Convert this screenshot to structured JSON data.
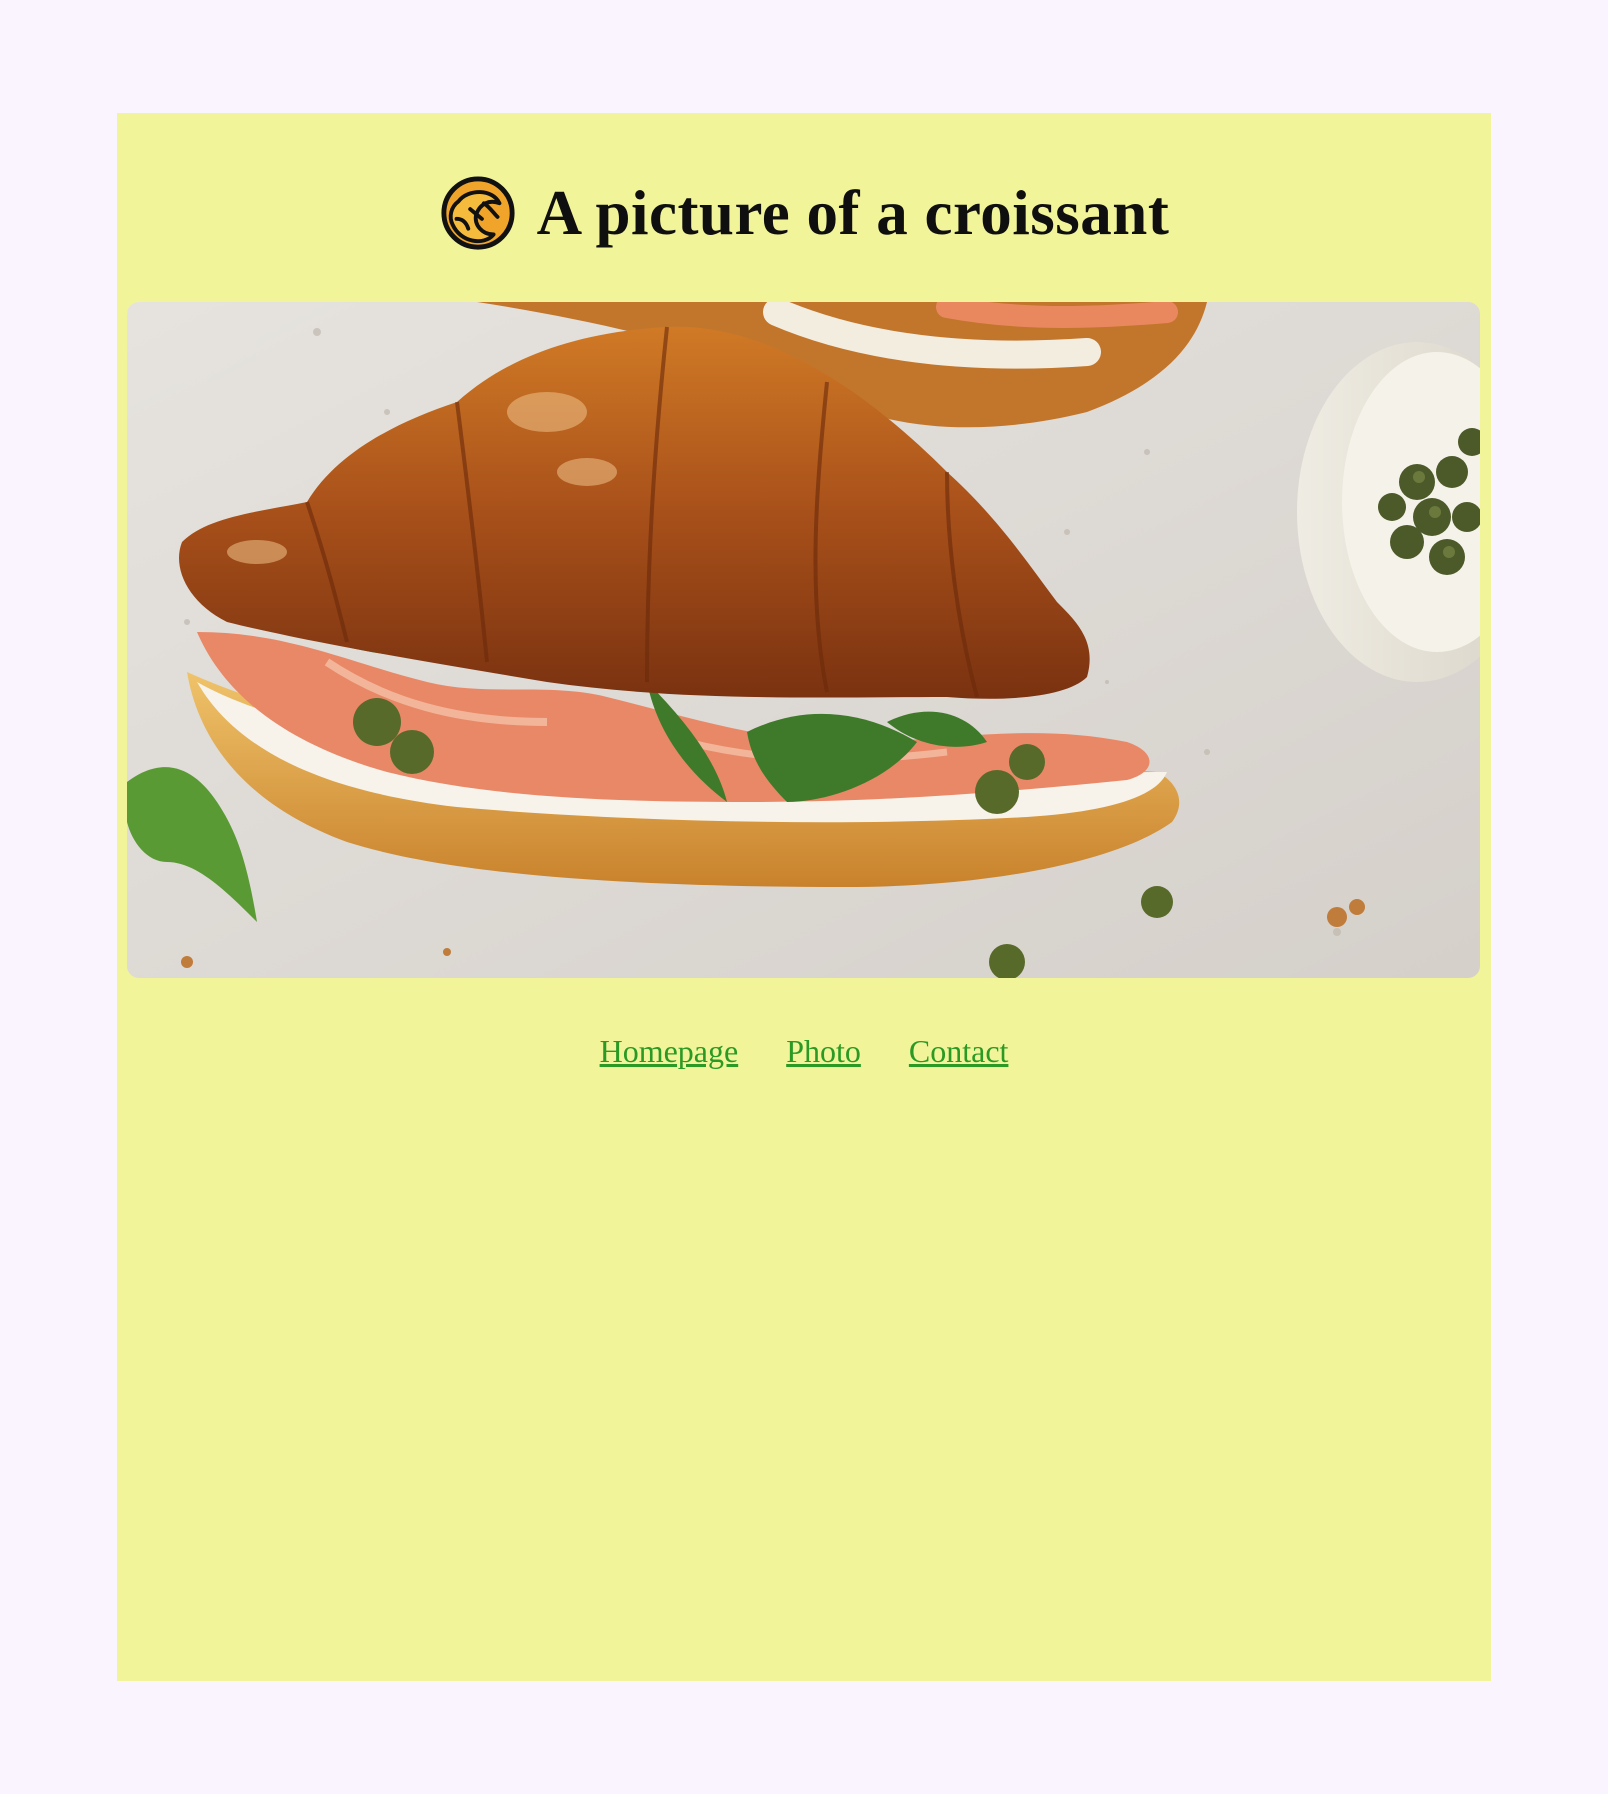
{
  "header": {
    "title": "A picture of a croissant",
    "logo_icon": "croissant-icon"
  },
  "photo": {
    "subject": "croissant-sandwich-image"
  },
  "nav": {
    "links": [
      {
        "label": "Homepage"
      },
      {
        "label": "Photo"
      },
      {
        "label": "Contact"
      }
    ]
  },
  "colors": {
    "page_background": "#faf4ff",
    "card_background": "#f2f49a",
    "link_color": "#2a9a24",
    "title_color": "#0f0f0f"
  }
}
